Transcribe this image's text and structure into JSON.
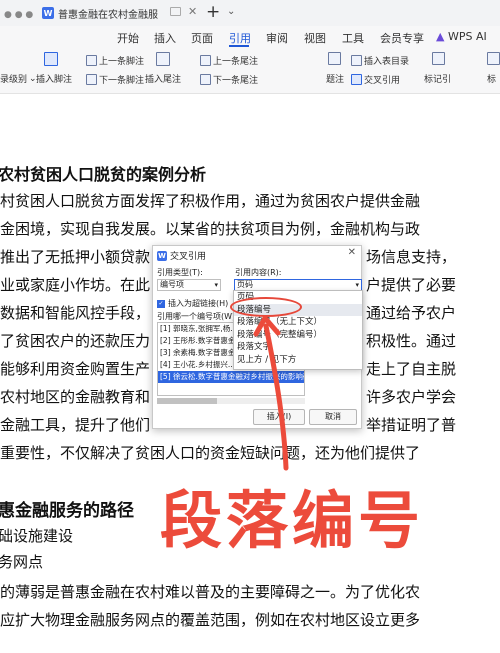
{
  "titlebar": {
    "tab_title": "普惠金融在农村金融服务中的..."
  },
  "menu": {
    "items": [
      "开始",
      "插入",
      "页面",
      "引用",
      "审阅",
      "视图",
      "工具",
      "会员专享",
      "WPS AI"
    ]
  },
  "ribbon": {
    "left_partial": "录级别",
    "insert_footnote": "插入脚注",
    "prev_footnote": "上一条脚注",
    "next_footnote": "下一条脚注",
    "insert_endnote": "插入尾注",
    "prev_endnote": "上一条尾注",
    "next_endnote": "下一条尾注",
    "insert_caption": "插入表目录",
    "question_note": "题注",
    "cross_reference": "交叉引用",
    "mark_citation": "标记引",
    "mark_partial": "标"
  },
  "document": {
    "heading1": "农村贫困人口脱贫的案例分析",
    "lines": [
      "村贫困人口脱贫方面发挥了积极作用，通过为贫困农户提供金融",
      "金困境，实现自我发展。以某省的扶贫项目为例，金融机构与政",
      "推出了无抵押小额贷款",
      "业或家庭小作坊。在此",
      "数据和智能风控手段，",
      "了贫困农户的还款压力",
      "能够利用资金购置生产",
      "农村地区的金融教育和",
      "金融工具，提升了他们",
      "重要性，不仅解决了贫困人口的资金短缺问题，还为他们提供了"
    ],
    "right_fragments": [
      "场信息支持，",
      "户提供了必要",
      "通过给予农户",
      "积极性。通过",
      "走上了自主脱",
      "许多农户学会",
      "举措证明了普"
    ],
    "heading2": "惠金融服务的路径",
    "heading3": "础设施建设",
    "sub": "务网点",
    "lines2": [
      "的薄弱是普惠金融在农村难以普及的主要障碍之一。为了优化农",
      "应扩大物理金融服务网点的覆盖范围，例如在农村地区设立更多"
    ]
  },
  "dialog": {
    "title": "交叉引用",
    "ref_type_label": "引用类型(T):",
    "ref_type_value": "编号项",
    "ref_content_label": "引用内容(R):",
    "ref_content_value": "页码",
    "hyperlink_label": "插入为超链接(H)",
    "which_label": "引用哪一个编号项(W)",
    "items": [
      "[1] 郭晓东,张拥军,杨...",
      "[2] 王彤彤.数字普惠金...",
      "[3] 余素梅.数字普惠金...",
      "[4] 王小花.乡村振兴...",
      "[5] 徐云松.数字普惠金融对乡村振兴的影响研究[J].贵州"
    ],
    "insert_button": "插入(I)",
    "cancel_button": "取消"
  },
  "dropdown": {
    "items": [
      "页码",
      "段落编号",
      "段落编号（无上下文）",
      "段落编号（完整编号）",
      "段落文字",
      "见上方 / 见下方"
    ]
  },
  "annotation": {
    "text": "段落编号"
  },
  "colors": {
    "accent": "#1f57d6",
    "annotation_red": "#ec4b3b",
    "selection": "#2f66e0"
  }
}
